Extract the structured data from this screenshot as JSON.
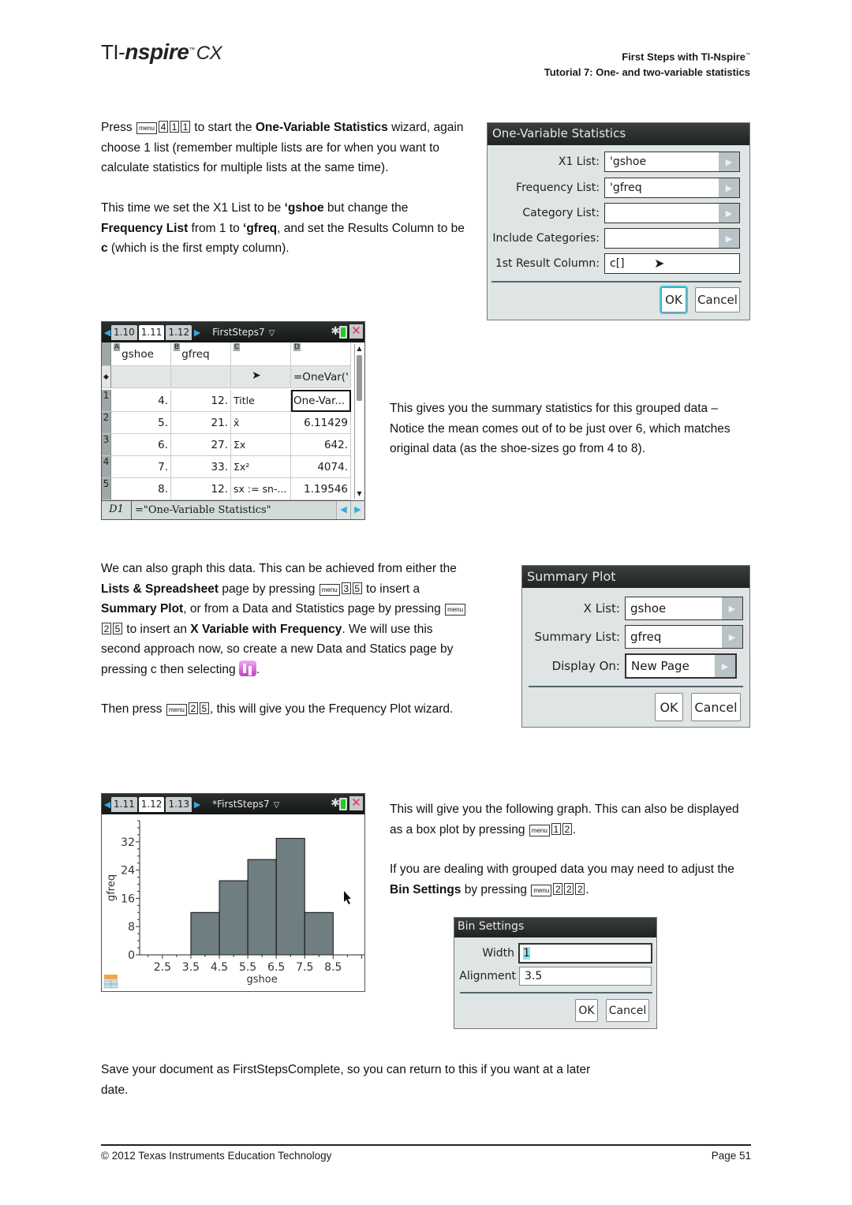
{
  "header": {
    "logo": {
      "ti": "TI-",
      "nspire": "nspire",
      "tm": "™",
      "cx": "CX"
    },
    "title_line1": "First Steps with TI-Nspire",
    "title_tm": "™",
    "title_line2": "Tutorial 7: One- and two-variable statistics"
  },
  "keys": {
    "menu": "menu",
    "k1": "1",
    "k2": "2",
    "k3": "3",
    "k4": "4",
    "k5": "5"
  },
  "section1": {
    "p1": {
      "t1": "Press ",
      "t2": " to start the ",
      "bold1": "One-Variable Statistics",
      "t3": " wizard, again choose 1 list (remember multiple lists are for when you want to calculate statistics for multiple lists at the same time)."
    },
    "p2": {
      "t1": "This time we set the X1 List to be ",
      "bold1": "‘gshoe",
      "t2": " but change the ",
      "bold2": "Frequency List",
      "t3": " from 1 to ",
      "bold3": "‘gfreq",
      "t4": ", and set the Results Column to be ",
      "bold4": "c",
      "t5": " (which is the first empty column)."
    }
  },
  "one_var_dialog": {
    "title": "One-Variable Statistics",
    "fields": [
      {
        "label": "X1 List:",
        "value": "'gshoe",
        "dropdown": true
      },
      {
        "label": "Frequency List:",
        "value": "'gfreq",
        "dropdown": true
      },
      {
        "label": "Category List:",
        "value": "",
        "dropdown": true
      },
      {
        "label": "Include Categories:",
        "value": "",
        "dropdown": true
      },
      {
        "label": "1st Result Column:",
        "value": "c[]",
        "dropdown": false
      }
    ],
    "ok": "OK",
    "cancel": "Cancel"
  },
  "spreadsheet_screen": {
    "tabs": [
      "1.10",
      "1.11",
      "1.12"
    ],
    "active_tab": "1.11",
    "doc_name": "FirstSteps7",
    "columns": [
      {
        "letter": "A",
        "name": "gshoe"
      },
      {
        "letter": "B",
        "name": "gfreq"
      },
      {
        "letter": "C",
        "name": ""
      },
      {
        "letter": "D",
        "name": ""
      }
    ],
    "formula_row": {
      "marker": "◆",
      "d": "=OneVar('"
    },
    "rows": [
      {
        "num": "1",
        "a": "4.",
        "b": "12.",
        "c": "Title",
        "d": "One-Var..."
      },
      {
        "num": "2",
        "a": "5.",
        "b": "21.",
        "c": "x̄",
        "d": "6.11429"
      },
      {
        "num": "3",
        "a": "6.",
        "b": "27.",
        "c": "Σx",
        "d": "642."
      },
      {
        "num": "4",
        "a": "7.",
        "b": "33.",
        "c": "Σx²",
        "d": "4074."
      },
      {
        "num": "5",
        "a": "8.",
        "b": "12.",
        "c": "sx := sn-...",
        "d": "1.19546"
      }
    ],
    "entry_ref": "D1",
    "entry_text": "=\"One-Variable Statistics\""
  },
  "section2": {
    "p1": "This gives you the summary statistics for this grouped data – Notice the mean comes out of to be just over 6, which matches original data (as the shoe-sizes go from 4 to 8)."
  },
  "section3": {
    "p1": {
      "t1": "We can also graph this data.  This can be achieved from either the ",
      "bold1": "Lists & Spreadsheet",
      "t2": " page by pressing ",
      "t3": " to insert a ",
      "bold2": "Summary Plot",
      "t4": ", or from a Data and Statistics page by pressing ",
      "t5": " to insert an ",
      "bold3": "X Variable with Frequency",
      "t6": ".  We will use this second approach now, so create a new Data and Statics page by pressing c then selecting ",
      "t7": "."
    },
    "p2": {
      "t1": "Then press ",
      "t2": ", this will give you the Frequency Plot wizard."
    }
  },
  "summary_plot_dialog": {
    "title": "Summary Plot",
    "fields": [
      {
        "label": "X List:",
        "value": "gshoe"
      },
      {
        "label": "Summary List:",
        "value": "gfreq"
      },
      {
        "label": "Display On:",
        "value": "New Page"
      }
    ],
    "ok": "OK",
    "cancel": "Cancel"
  },
  "graph_screen": {
    "tabs": [
      "1.11",
      "1.12",
      "1.13"
    ],
    "active_tab": "1.12",
    "doc_name": "*FirstSteps7"
  },
  "chart_data": {
    "type": "bar",
    "title": "",
    "xlabel": "gshoe",
    "ylabel": "gfreq",
    "bins": [
      {
        "from": 3.5,
        "to": 4.5,
        "value": 12
      },
      {
        "from": 4.5,
        "to": 5.5,
        "value": 21
      },
      {
        "from": 5.5,
        "to": 6.5,
        "value": 27
      },
      {
        "from": 6.5,
        "to": 7.5,
        "value": 33
      },
      {
        "from": 7.5,
        "to": 8.5,
        "value": 12
      }
    ],
    "x_ticks": [
      "2.5",
      "3.5",
      "4.5",
      "5.5",
      "6.5",
      "7.5",
      "8.5"
    ],
    "y_ticks": [
      "0",
      "8",
      "16",
      "24",
      "32"
    ],
    "xlim": [
      1.7,
      9.6
    ],
    "ylim": [
      0,
      38
    ],
    "grid": false
  },
  "section4": {
    "p1": {
      "t1": "This will give you the following graph.  This can also be displayed as a box plot by pressing ",
      "t2": "."
    },
    "p2": {
      "t1": "If you are dealing with grouped data you may need to adjust the ",
      "bold1": "Bin Settings",
      "t2": " by pressing ",
      "t3": "."
    }
  },
  "bin_settings_dialog": {
    "title": "Bin Settings",
    "width_label": "Width",
    "width_value": "1",
    "alignment_label": "Alignment",
    "alignment_value": "3.5",
    "ok": "OK",
    "cancel": "Cancel"
  },
  "section5": {
    "p1": "Save your document as FirstStepsComplete, so you can return to this if you want at a later date."
  },
  "footer": {
    "copyright": "© 2012 Texas Instruments Education Technology",
    "page": "Page  51"
  }
}
